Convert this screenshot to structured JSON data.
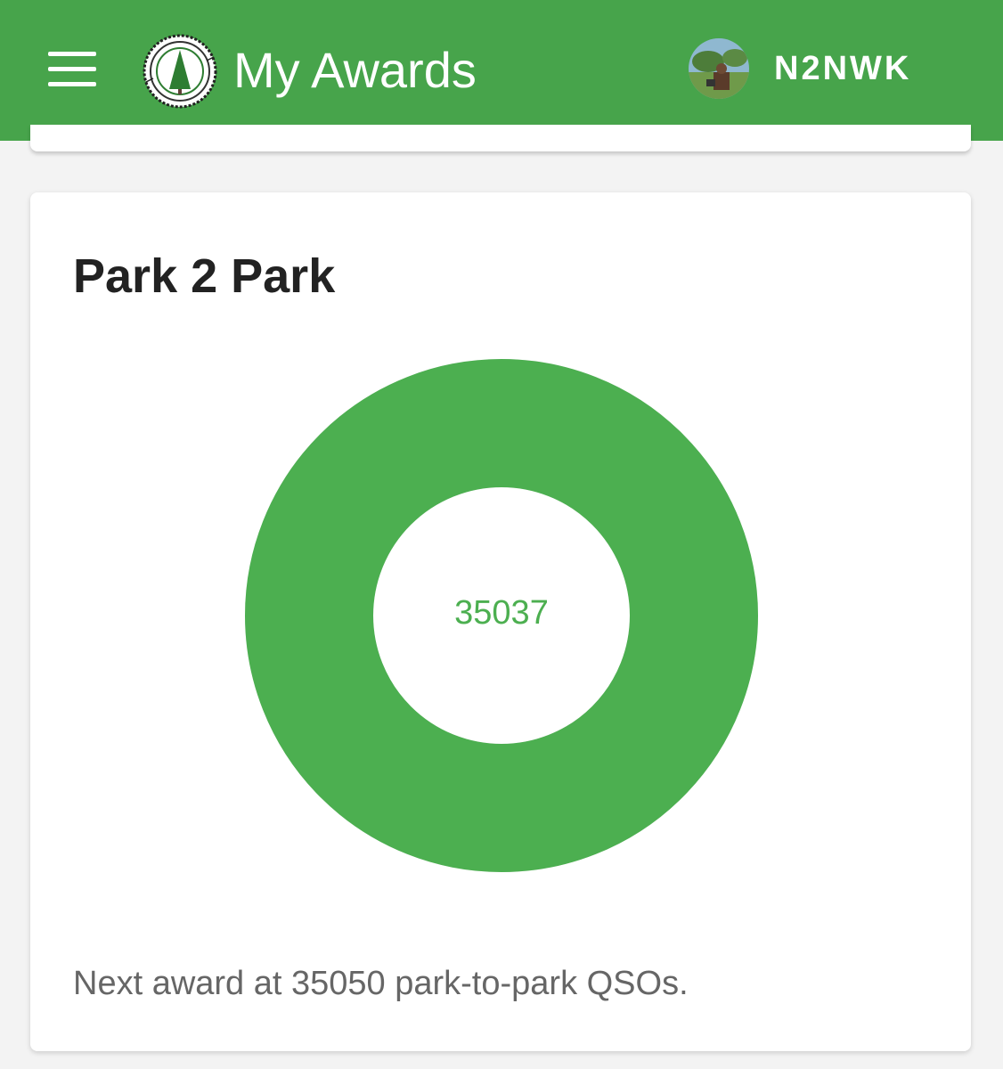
{
  "header": {
    "title": "My Awards",
    "username": "N2NWK",
    "menu_icon": "hamburger-menu-icon",
    "logo_icon": "pota-logo-icon",
    "avatar_icon": "user-avatar"
  },
  "card": {
    "title": "Park 2 Park",
    "progress_value": "35037",
    "progress_fraction": 1.0,
    "next_award_text": "Next award at 35050 park-to-park QSOs."
  },
  "colors": {
    "app_bar": "#47a44b",
    "donut": "#4caf50",
    "value_text": "#4caf50"
  }
}
